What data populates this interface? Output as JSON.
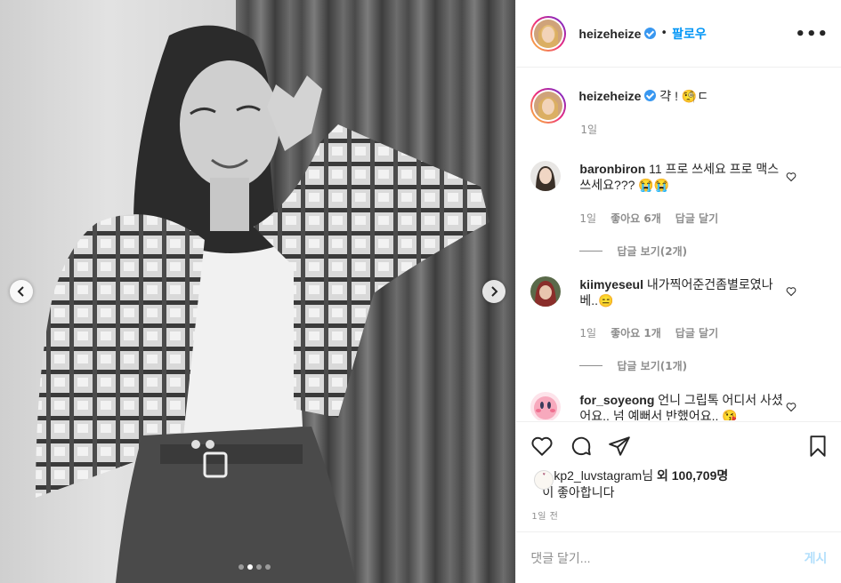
{
  "header": {
    "username": "heizeheize",
    "separator": "•",
    "follow_label": "팔로우",
    "more_label": "•••"
  },
  "caption": {
    "username": "heizeheize",
    "text": " 갹 ! 🧐ㄷ",
    "time": "1일"
  },
  "comments": [
    {
      "username": "baronbiron",
      "text": " 11 프로 쓰세요 프로 맥스 쓰세요??? 😭😭",
      "time": "1일",
      "likes": "좋아요 6개",
      "reply": "답글 달기",
      "view_replies": "답글 보기(2개)"
    },
    {
      "username": "kiimyeseul",
      "text": " 내가찍어준건좀별로였나베..😑",
      "time": "1일",
      "likes": "좋아요 1개",
      "reply": "답글 달기",
      "view_replies": "답글 보기(1개)"
    },
    {
      "username": "for_soyeong",
      "text": " 언니 그립톡 어디서 사셨어요.. 넘 예뻐서 반했어요.. 😘"
    }
  ],
  "likes": {
    "liker": "kp2_luvstagram",
    "suffix": "님 ",
    "count_text": "외 100,709명",
    "line2": "이 좋아합니다"
  },
  "date": "1일 전",
  "composer": {
    "placeholder": "댓글 달기...",
    "post_label": "게시"
  },
  "carousel": {
    "total_images": 4,
    "active_index": 1
  },
  "colors": {
    "link": "#0095f6",
    "muted": "#8e8e8e",
    "border": "#efefef",
    "verified": "#3897f0"
  }
}
